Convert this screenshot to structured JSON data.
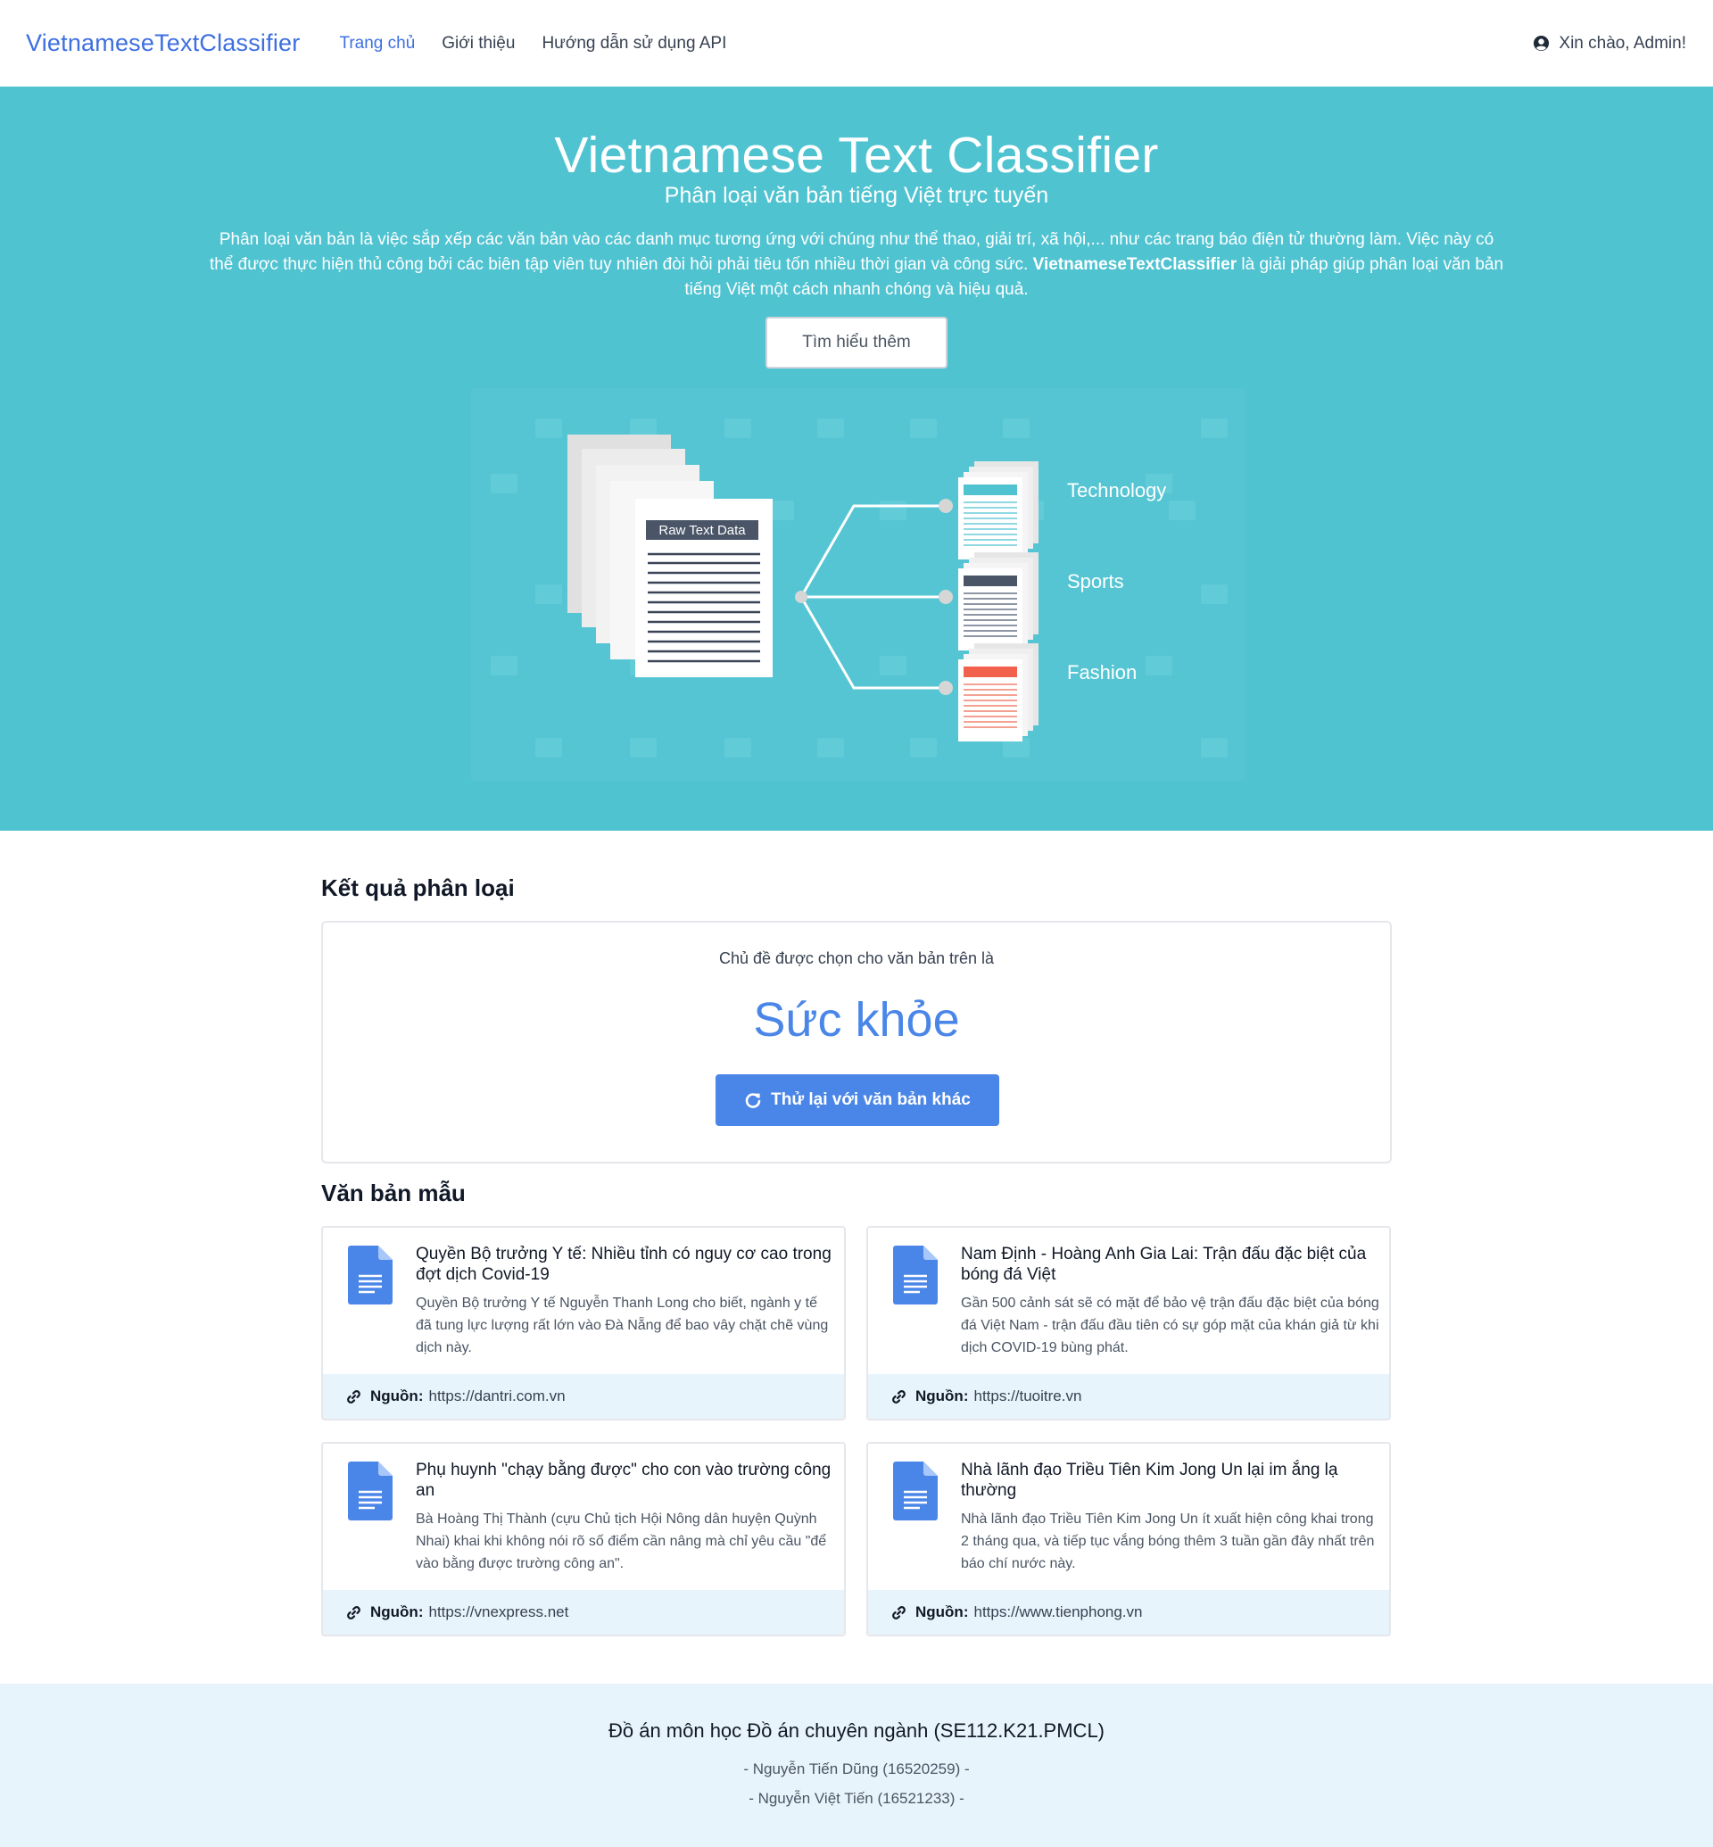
{
  "navbar": {
    "brand": "VietnameseTextClassifier",
    "links": [
      {
        "label": "Trang chủ",
        "active": true
      },
      {
        "label": "Giới thiệu",
        "active": false
      },
      {
        "label": "Hướng dẫn sử dụng API",
        "active": false
      }
    ],
    "greeting": "Xin chào, Admin!"
  },
  "hero": {
    "title": "Vietnamese Text Classifier",
    "subtitle": "Phân loại văn bản tiếng Việt trực tuyến",
    "desc_part1": "Phân loại văn bản là việc sắp xếp các văn bản vào các danh mục tương ứng với chúng như thể thao, giải trí, xã hội,... như các trang báo điện tử thường làm. Việc này có thể được thực hiện thủ công bởi các biên tập viên tuy nhiên đòi hỏi phải tiêu tốn nhiều thời gian và công sức.",
    "desc_bold": "VietnameseTextClassifier",
    "desc_part2": "là giải pháp giúp phân loại văn bản tiếng Việt một cách nhanh chóng và hiệu quả.",
    "button": "Tìm hiểu thêm",
    "illustration": {
      "raw_label": "Raw Text Data",
      "categories": [
        "Technology",
        "Sports",
        "Fashion"
      ]
    }
  },
  "result": {
    "heading": "Kết quả phân loại",
    "caption": "Chủ đề được chọn cho văn bản trên là",
    "value": "Sức khỏe",
    "retry": "Thử lại với văn bản khác"
  },
  "samples": {
    "heading": "Văn bản mẫu",
    "source_label": "Nguồn:",
    "items": [
      {
        "title": "Quyền Bộ trưởng Y tế: Nhiều tỉnh có nguy cơ cao trong đợt dịch Covid-19",
        "desc": "Quyền Bộ trưởng Y tế Nguyễn Thanh Long cho biết, ngành y tế đã tung lực lượng rất lớn vào Đà Nẵng để bao vây chặt chẽ vùng dịch này.",
        "source": "https://dantri.com.vn"
      },
      {
        "title": "Nam Định - Hoàng Anh Gia Lai: Trận đấu đặc biệt của bóng đá Việt",
        "desc": "Gần 500 cảnh sát sẽ có mặt để bảo vệ trận đấu đặc biệt của bóng đá Việt Nam - trận đấu đầu tiên có sự góp mặt của khán giả từ khi dịch COVID-19 bùng phát.",
        "source": "https://tuoitre.vn"
      },
      {
        "title": "Phụ huynh \"chạy bằng được\" cho con vào trường công an",
        "desc": "Bà Hoàng Thị Thành (cựu Chủ tịch Hội Nông dân huyện Quỳnh Nhai) khai khi không nói rõ số điểm cần nâng mà chỉ yêu cầu \"để vào bằng được trường công an\".",
        "source": "https://vnexpress.net"
      },
      {
        "title": "Nhà lãnh đạo Triều Tiên Kim Jong Un lại im ắng lạ thường",
        "desc": "Nhà lãnh đạo Triều Tiên Kim Jong Un ít xuất hiện công khai trong 2 tháng qua, và tiếp tục vắng bóng thêm 3 tuần gần đây nhất trên báo chí nước này.",
        "source": "https://www.tienphong.vn"
      }
    ]
  },
  "footer": {
    "title": "Đồ án môn học Đồ án chuyên ngành (SE112.K21.PMCL)",
    "members": [
      "- Nguyễn Tiến Dũng (16520259) -",
      "- Nguyễn Việt Tiến (16521233) -"
    ]
  },
  "colors": {
    "brand": "#3d6fe0",
    "hero_bg": "#50c3d1",
    "accent": "#4a86e8",
    "footer_bg": "#e8f4fc"
  }
}
